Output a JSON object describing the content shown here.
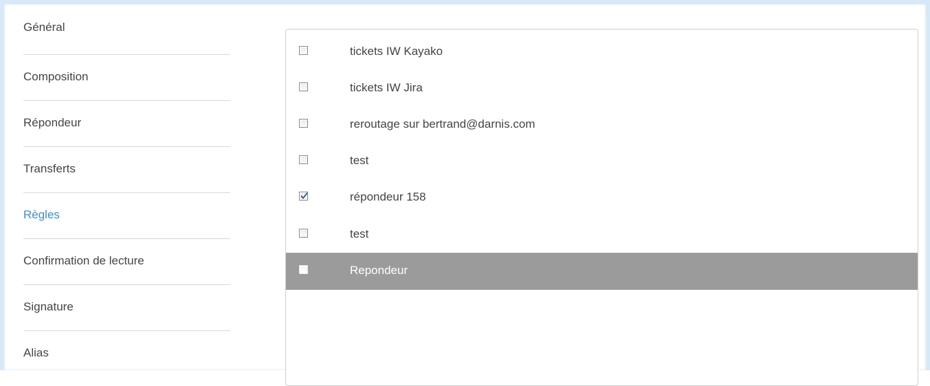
{
  "sidebar": {
    "items": [
      {
        "label": "Général",
        "active": false
      },
      {
        "label": "Composition",
        "active": false
      },
      {
        "label": "Répondeur",
        "active": false
      },
      {
        "label": "Transferts",
        "active": false
      },
      {
        "label": "Règles",
        "active": true
      },
      {
        "label": "Confirmation de lecture",
        "active": false
      },
      {
        "label": "Signature",
        "active": false
      },
      {
        "label": "Alias",
        "active": false
      }
    ]
  },
  "rules": {
    "items": [
      {
        "label": "tickets IW Kayako",
        "checked": false,
        "selected": false
      },
      {
        "label": "tickets IW Jira",
        "checked": false,
        "selected": false
      },
      {
        "label": "reroutage sur bertrand@darnis.com",
        "checked": false,
        "selected": false
      },
      {
        "label": "test",
        "checked": false,
        "selected": false
      },
      {
        "label": "répondeur 158",
        "checked": true,
        "selected": false
      },
      {
        "label": "test",
        "checked": false,
        "selected": false
      },
      {
        "label": "Repondeur",
        "checked": false,
        "selected": true
      }
    ]
  },
  "colors": {
    "accent": "#3b8fd6",
    "selected_row": "#9b9b9b",
    "frame_border": "#d7e9f8"
  }
}
